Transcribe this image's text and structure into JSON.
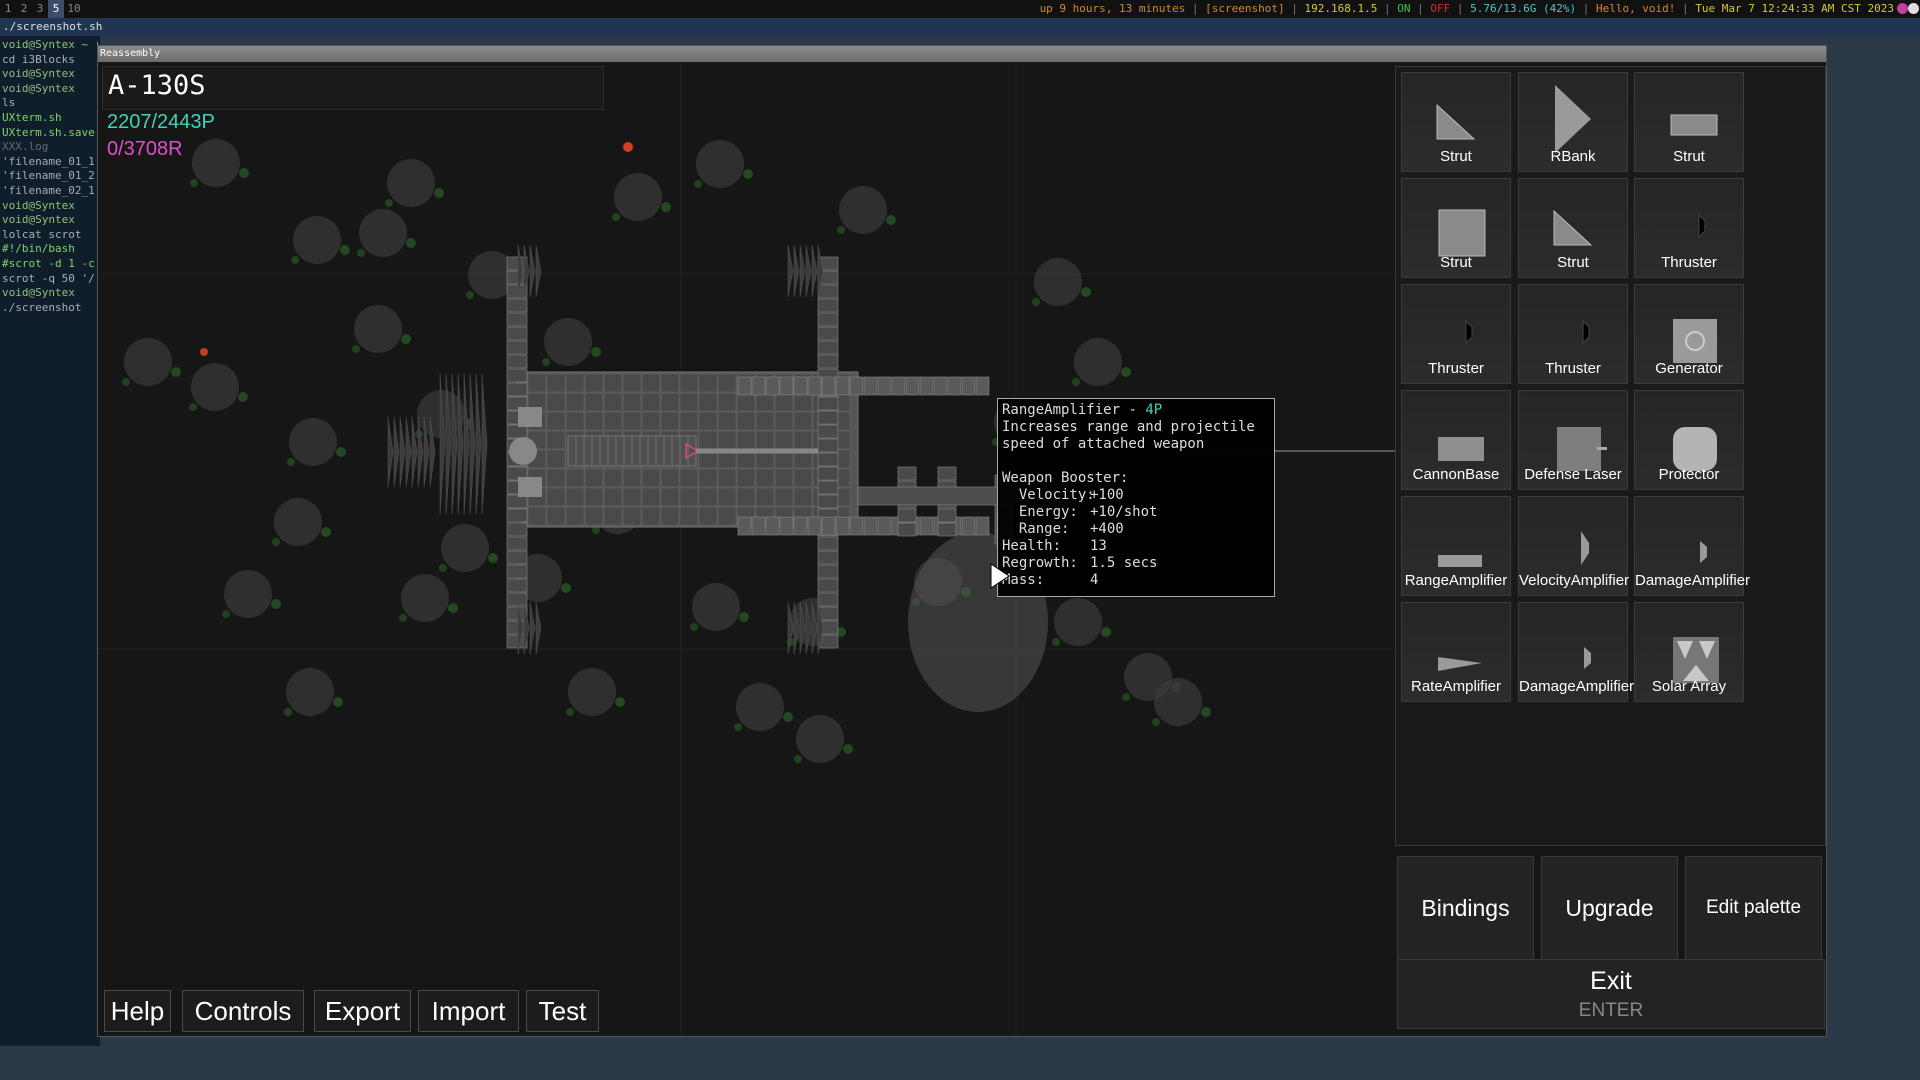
{
  "topbar": {
    "workspaces": [
      "1",
      "2",
      "3",
      "5",
      "10"
    ],
    "active_workspace": "5",
    "status": {
      "uptime": "up 9 hours, 13 minutes",
      "screenshot": "[screenshot]",
      "ip": "192.168.1.5",
      "on": "ON",
      "off": "OFF",
      "memory": "5.76/13.6G (42%)",
      "greeting": "Hello, void!",
      "datetime": "Tue Mar  7 12:24:33 AM CST 2023"
    }
  },
  "terminal": {
    "title": "./screenshot.sh",
    "lines": [
      {
        "t": "void@Syntex ~ (main)",
        "c": "g"
      },
      {
        "t": "  cd i3Blocks",
        "c": "q"
      },
      {
        "t": "void@Syntex",
        "c": "g"
      },
      {
        "t": "  ",
        "c": "q"
      },
      {
        "t": "void@Syntex",
        "c": "g"
      },
      {
        "t": "  ls",
        "c": "q"
      },
      {
        "t": " UXterm.sh",
        "c": "gr"
      },
      {
        "t": " UXterm.sh.save",
        "c": "gr"
      },
      {
        "t": " XXX.log",
        "c": "gray"
      },
      {
        "t": "'filename_01_1",
        "c": "w"
      },
      {
        "t": "'filename_01_2",
        "c": "w"
      },
      {
        "t": "'filename_02_1",
        "c": "w"
      },
      {
        "t": "void@Syntex",
        "c": "g"
      },
      {
        "t": "  ",
        "c": "q"
      },
      {
        "t": "void@Syntex",
        "c": "g"
      },
      {
        "t": "  lolcat scrot",
        "c": "q"
      },
      {
        "t": "#!/bin/bash",
        "c": "gr"
      },
      {
        "t": "",
        "c": "q"
      },
      {
        "t": "#scrot -d 1 -c",
        "c": "gr"
      },
      {
        "t": "",
        "c": "q"
      },
      {
        "t": "scrot -q 50 '/",
        "c": "q"
      },
      {
        "t": "void@Syntex",
        "c": "g"
      },
      {
        "t": "  ./screenshot",
        "c": "q"
      }
    ]
  },
  "game": {
    "window_title": "Reassembly",
    "ship_name": "A-130S",
    "p_count": "2207/2443P",
    "r_count": "0/3708R",
    "tooltip": {
      "name": "RangeAmplifier",
      "dash": " - ",
      "cost": "4P",
      "desc1": "Increases range and projectile",
      "desc2": "speed of attached weapon",
      "booster": "Weapon Booster:",
      "velocity_label": "  Velocity:",
      "velocity": "+100",
      "energy_label": "  Energy:",
      "energy": "+10/shot",
      "range_label": "  Range:",
      "range": "+400",
      "health_label": "Health:",
      "health": "13",
      "regrowth_label": "Regrowth:",
      "regrowth": "1.5 secs",
      "mass_label": "Mass:",
      "mass": "4"
    },
    "palette": [
      {
        "label": "Strut",
        "icon": "right-triangle-icon"
      },
      {
        "label": "RBank",
        "icon": "triangle-icon"
      },
      {
        "label": "Strut",
        "icon": "rectangle-icon"
      },
      {
        "label": "Strut",
        "icon": "square-icon"
      },
      {
        "label": "Strut",
        "icon": "right-triangle-icon"
      },
      {
        "label": "Thruster",
        "icon": "thruster-icon"
      },
      {
        "label": "Thruster",
        "icon": "thruster-icon"
      },
      {
        "label": "Thruster",
        "icon": "thruster-icon"
      },
      {
        "label": "Generator",
        "icon": "generator-icon"
      },
      {
        "label": "CannonBase",
        "icon": "cannon-base-icon"
      },
      {
        "label": "Defense Laser",
        "icon": "defense-laser-icon"
      },
      {
        "label": "Protector",
        "icon": "protector-icon"
      },
      {
        "label": "RangeAmplifier",
        "icon": "range-amplifier-icon"
      },
      {
        "label": "VelocityAmplifier",
        "icon": "velocity-amplifier-icon"
      },
      {
        "label": "DamageAmplifier",
        "icon": "damage-amplifier-icon"
      },
      {
        "label": "RateAmplifier",
        "icon": "rate-amplifier-icon"
      },
      {
        "label": "DamageAmplifier",
        "icon": "damage-amplifier-icon"
      },
      {
        "label": "Solar Array",
        "icon": "solar-array-icon"
      }
    ],
    "actions": {
      "bindings": "Bindings",
      "upgrade": "Upgrade",
      "edit_palette": "Edit palette",
      "exit": "Exit",
      "exit_key": "ENTER"
    },
    "bottom_buttons": {
      "help": "Help",
      "controls": "Controls",
      "export": "Export",
      "import": "Import",
      "test": "Test"
    }
  }
}
